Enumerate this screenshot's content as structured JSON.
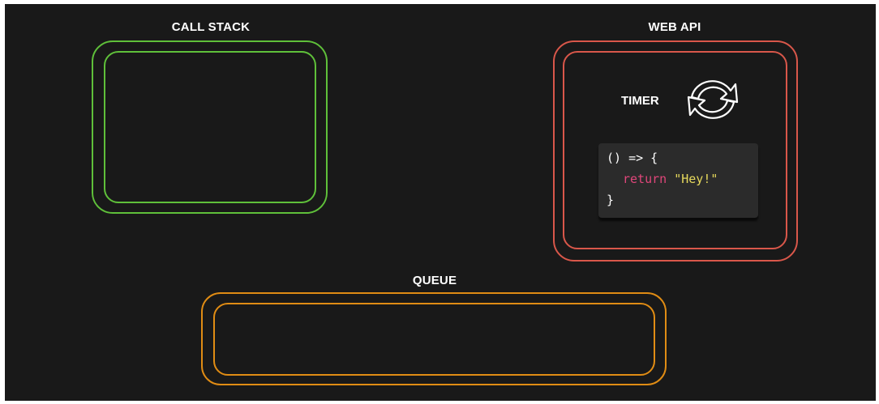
{
  "labels": {
    "call_stack": "CALL STACK",
    "web_api": "WEB API",
    "queue": "QUEUE",
    "timer": "TIMER"
  },
  "code": {
    "line1": "() => {",
    "keyword": "return",
    "string": "\"Hey!\"",
    "line3": "}"
  },
  "icons": {
    "timer": "refresh-cycle-icon"
  },
  "colors": {
    "background": "#191919",
    "call_stack": "#5fc03a",
    "web_api": "#d9574a",
    "queue": "#e08c14",
    "keyword": "#e0467a",
    "string": "#e6d85c",
    "code_bg": "#2b2b2b"
  }
}
